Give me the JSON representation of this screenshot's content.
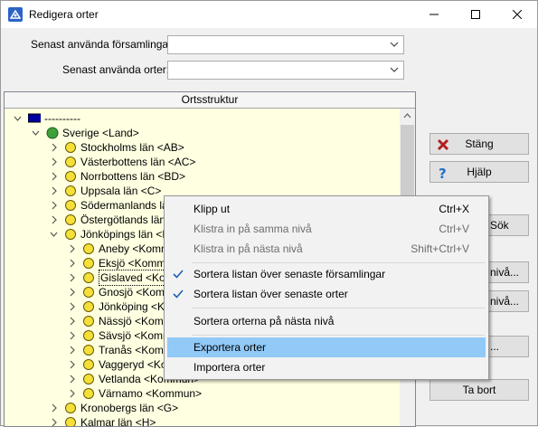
{
  "window": {
    "title": "Redigera orter"
  },
  "filters": {
    "recent_parishes_label": "Senast använda församlingar:",
    "recent_parishes_value": "",
    "recent_places_label": "Senast använda orter:",
    "recent_places_value": ""
  },
  "tree": {
    "header": "Ortsstruktur",
    "nodes": [
      {
        "label": "----------",
        "icon": "flag-icon",
        "expanded": true
      },
      {
        "label": "Sverige <Land>",
        "icon": "globe-icon",
        "expanded": true
      },
      {
        "label": "Stockholms län <AB>"
      },
      {
        "label": "Västerbottens län <AC>"
      },
      {
        "label": "Norrbottens län <BD>"
      },
      {
        "label": "Uppsala län <C>"
      },
      {
        "label": "Södermanlands län"
      },
      {
        "label": "Östergötlands län"
      },
      {
        "label": "Jönköpings län <F",
        "expanded": true
      },
      {
        "label": "Aneby <Kommu"
      },
      {
        "label": "Eksjö <Kommun"
      },
      {
        "label": "Gislaved <Kom",
        "selected": true
      },
      {
        "label": "Gnosjö <Komm"
      },
      {
        "label": "Jönköping <Ko"
      },
      {
        "label": "Nässjö <Kommu"
      },
      {
        "label": "Sävsjö <Kommu"
      },
      {
        "label": "Tranås <Komm"
      },
      {
        "label": "Vaggeryd <Ko"
      },
      {
        "label": "Vetlanda <Kommun>"
      },
      {
        "label": "Värnamo <Kommun>"
      },
      {
        "label": "Kronobergs län <G>"
      },
      {
        "label": "Kalmar län <H>"
      }
    ]
  },
  "buttons": {
    "close": "Stäng",
    "help": "Hjälp",
    "search": "Sök",
    "new_level_1": "nivå...",
    "new_level_2": "nivå...",
    "edit": "...",
    "delete": "Ta bort"
  },
  "context_menu": {
    "items": [
      {
        "label": "Klipp ut",
        "shortcut": "Ctrl+X"
      },
      {
        "label": "Klistra in på samma nivå",
        "shortcut": "Ctrl+V",
        "disabled": true
      },
      {
        "label": "Klistra in på nästa nivå",
        "shortcut": "Shift+Ctrl+V",
        "disabled": true
      },
      {
        "label": "Sortera listan över senaste församlingar",
        "checked": true
      },
      {
        "label": "Sortera listan över senaste orter",
        "checked": true
      },
      {
        "label": "Sortera orterna på nästa nivå"
      },
      {
        "label": "Exportera orter",
        "highlighted": true
      },
      {
        "label": "Importera orter"
      }
    ]
  },
  "colors": {
    "tree_background": "#ffffe1",
    "menu_highlight": "#91c9f7",
    "node_icon_yellow": "#f5e03a",
    "close_icon_red": "#b41e1e",
    "help_icon_blue": "#1e6ec8"
  }
}
